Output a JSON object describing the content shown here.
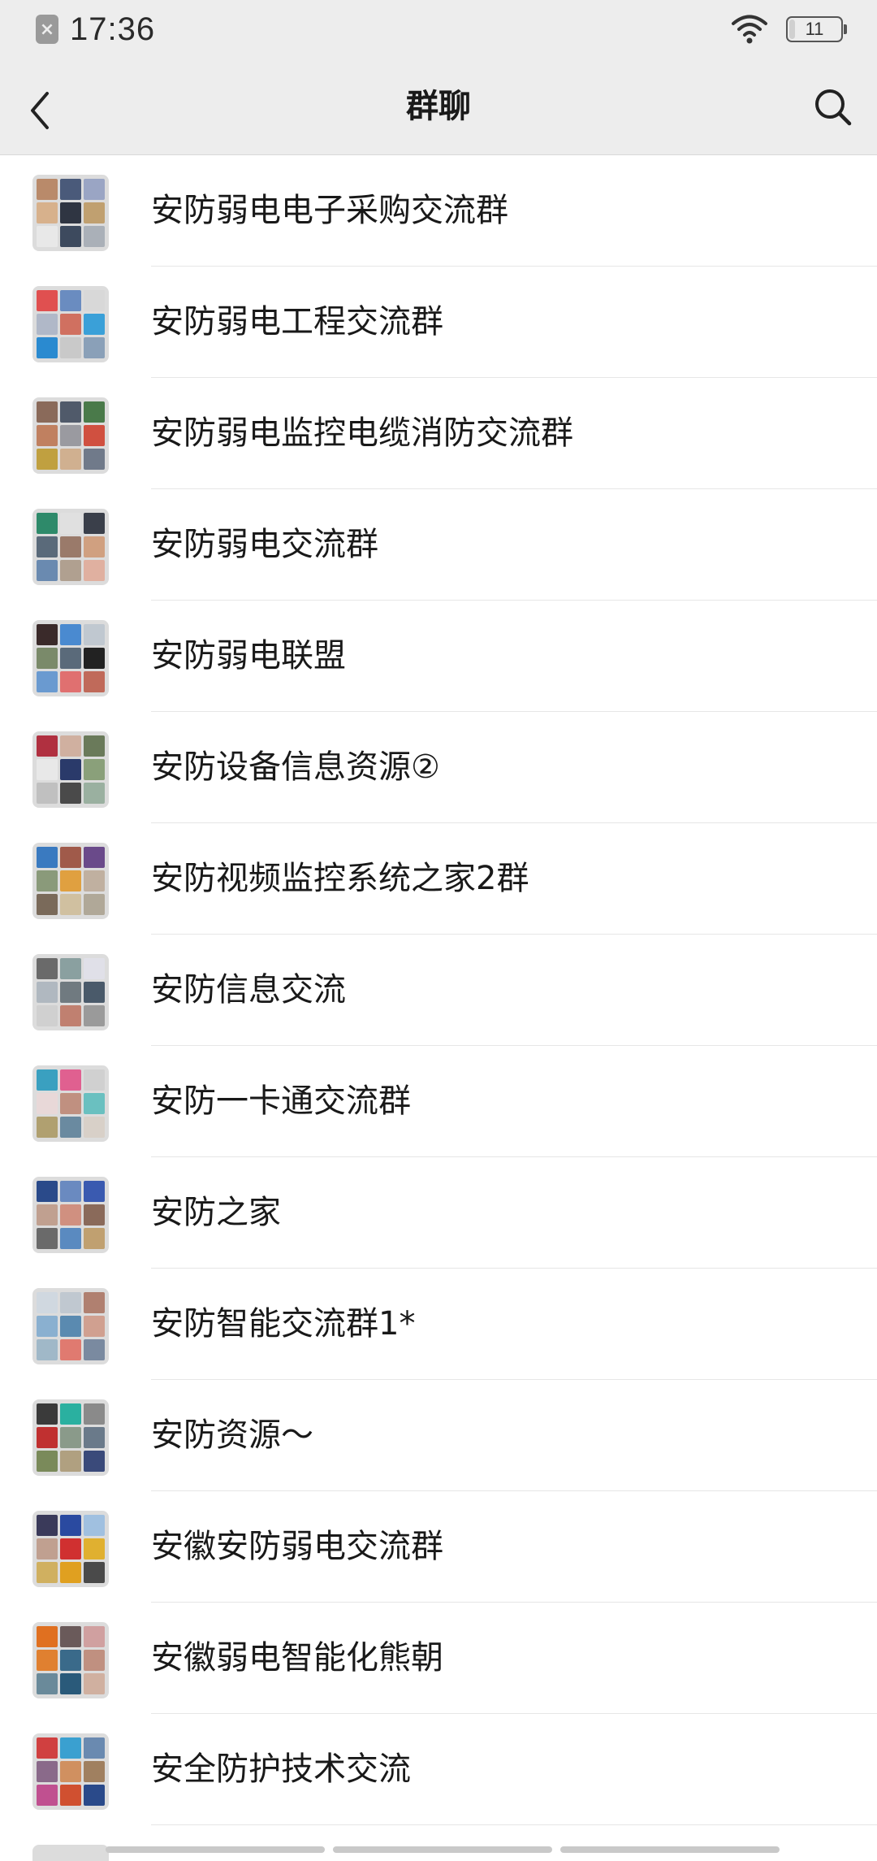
{
  "status_bar": {
    "time": "17:36",
    "battery_level": "11",
    "battery_fraction": 0.11,
    "sim_icon": "sim-error-icon",
    "wifi_icon": "wifi-icon"
  },
  "nav": {
    "title": "群聊",
    "back_icon": "chevron-left-icon",
    "search_icon": "search-icon"
  },
  "groups": [
    {
      "name": "安防弱电电子采购交流群",
      "tiles": [
        "#b98a6a",
        "#4a5a7a",
        "#9aa5c4",
        "#d7b18c",
        "#2f3542",
        "#c0a070",
        "#e8e8e8",
        "#3d4a5e",
        "#aab0b8"
      ]
    },
    {
      "name": "安防弱电工程交流群",
      "tiles": [
        "#e05050",
        "#6a8cc0",
        "#d8d8d8",
        "#b0b8c8",
        "#d07060",
        "#3aa0d8",
        "#2a8ad0",
        "#c9c9c9",
        "#8aa0b8"
      ]
    },
    {
      "name": "安防弱电监控电缆消防交流群",
      "tiles": [
        "#8a6a5a",
        "#505a6a",
        "#4a7a4a",
        "#c08060",
        "#9a9aa0",
        "#d05040",
        "#c0a040",
        "#d0b090",
        "#707a8a"
      ]
    },
    {
      "name": "安防弱电交流群",
      "tiles": [
        "#2e8a6a",
        "#e0e0e0",
        "#3a3f4a",
        "#5a6a7a",
        "#9a7a6a",
        "#d0a080",
        "#6a8ab0",
        "#b0a090",
        "#e0b0a0"
      ]
    },
    {
      "name": "安防弱电联盟",
      "tiles": [
        "#3a2a2a",
        "#4a8ad0",
        "#c0c8d0",
        "#7a8a6a",
        "#5a6a7a",
        "#222222",
        "#6a9ad0",
        "#e07070",
        "#c06a5a"
      ]
    },
    {
      "name": "安防设备信息资源②",
      "tiles": [
        "#b03040",
        "#d0b0a0",
        "#6a7a5a",
        "#e8e8e8",
        "#2a3a6a",
        "#8aa07a",
        "#c0c0c0",
        "#4a4a4a",
        "#9ab0a0"
      ]
    },
    {
      "name": "安防视频监控系统之家2群",
      "tiles": [
        "#3a7ac0",
        "#a05a4a",
        "#6a4a8a",
        "#8a9a7a",
        "#e0a040",
        "#c0b0a0",
        "#7a6a5a",
        "#d0c0a0",
        "#b0a898"
      ]
    },
    {
      "name": "安防信息交流",
      "tiles": [
        "#6a6a6a",
        "#8aa0a0",
        "#e0e0e8",
        "#b0b8c0",
        "#707a80",
        "#4a5a6a",
        "#d0d0d0",
        "#c08070",
        "#9a9a9a"
      ]
    },
    {
      "name": "安防一卡通交流群",
      "tiles": [
        "#3aa0c0",
        "#e06090",
        "#d0d0d0",
        "#e8d8d8",
        "#c09080",
        "#6ac0c0",
        "#b0a070",
        "#6a8aa0",
        "#d8d0c8"
      ]
    },
    {
      "name": "安防之家",
      "tiles": [
        "#2a4a8a",
        "#6a8ac0",
        "#3a5ab0",
        "#c0a090",
        "#d09080",
        "#8a6a5a",
        "#6a6a6a",
        "#5a8ac0",
        "#c0a070"
      ]
    },
    {
      "name": "安防智能交流群1*",
      "tiles": [
        "#d0d8e0",
        "#c0c8d0",
        "#b08070",
        "#8ab0d0",
        "#5a8ab0",
        "#d0a090",
        "#a0b8c8",
        "#e07a70",
        "#7a8aa0"
      ]
    },
    {
      "name": "安防资源～",
      "tiles": [
        "#3a3a3a",
        "#2ab0a0",
        "#8a8a8a",
        "#c03030",
        "#8a9a8a",
        "#6a7a8a",
        "#7a8a5a",
        "#b0a080",
        "#3a4a7a"
      ]
    },
    {
      "name": "安徽安防弱电交流群",
      "tiles": [
        "#3a3a5a",
        "#2a4aa0",
        "#a0c0e0",
        "#c0a090",
        "#d03030",
        "#e0b030",
        "#d0b060",
        "#e0a020",
        "#4a4a4a"
      ]
    },
    {
      "name": "安徽弱电智能化熊朝",
      "tiles": [
        "#e07020",
        "#6a5a5a",
        "#d0a0a0",
        "#e08030",
        "#3a6a8a",
        "#c09080",
        "#6a8a9a",
        "#2a5a7a",
        "#d0b0a0"
      ]
    },
    {
      "name": "安全防护技术交流",
      "tiles": [
        "#d04040",
        "#3aa0d0",
        "#6a8ab0",
        "#8a6a8a",
        "#d09060",
        "#a08060",
        "#c05090",
        "#d05030",
        "#2a4a8a"
      ]
    }
  ]
}
